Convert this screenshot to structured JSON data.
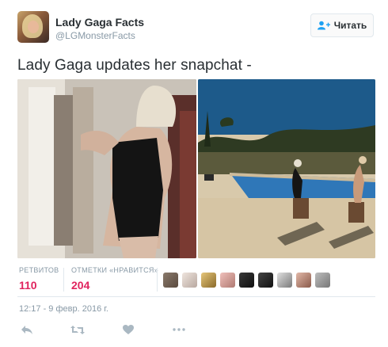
{
  "author": {
    "name": "Lady Gaga Facts",
    "handle": "@LGMonsterFacts"
  },
  "follow_button": {
    "label": "Читать",
    "icon": "follow-icon"
  },
  "tweet": {
    "text": "Lady Gaga updates her snapchat -"
  },
  "stats": {
    "retweets": {
      "label": "РЕТВИТОВ",
      "value": "110"
    },
    "likes": {
      "label": "ОТМЕТКИ «НРАВИТСЯ»",
      "value": "204"
    }
  },
  "likers": [
    {
      "name": "liker-1",
      "color": "#7a6a5c"
    },
    {
      "name": "liker-2",
      "color": "#d8c8c0"
    },
    {
      "name": "liker-3",
      "color": "#c8a45a"
    },
    {
      "name": "liker-4",
      "color": "#d9a3a0"
    },
    {
      "name": "liker-5",
      "color": "#1f1f1f"
    },
    {
      "name": "liker-6",
      "color": "#2a2a2a"
    },
    {
      "name": "liker-7",
      "color": "#b7b7b7"
    },
    {
      "name": "liker-8",
      "color": "#c59a8a"
    },
    {
      "name": "liker-9",
      "color": "#9a9a9a"
    }
  ],
  "timestamp": "12:17 - 9 февр. 2016 г.",
  "actions": [
    "reply-icon",
    "retweet-icon",
    "like-icon",
    "more-icon"
  ],
  "colors": {
    "likes": "#e0245e",
    "muted": "#8899a6",
    "text": "#292f33",
    "border": "#e1e8ed"
  }
}
